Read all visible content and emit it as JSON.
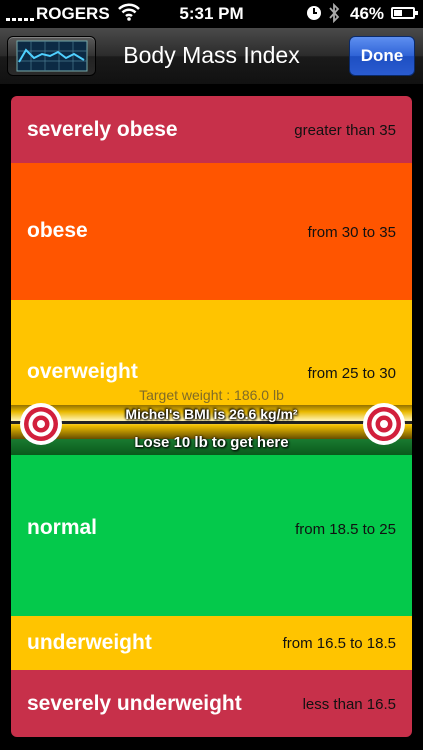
{
  "status_bar": {
    "carrier": "ROGERS",
    "time": "5:31 PM",
    "battery": "46%",
    "battery_level": 0.46
  },
  "nav": {
    "title": "Body Mass Index",
    "done_label": "Done"
  },
  "categories": [
    {
      "name": "severely obese",
      "range": "greater than 35",
      "color": "#c7304a"
    },
    {
      "name": "obese",
      "range": "from 30 to 35",
      "color": "#ff5500"
    },
    {
      "name": "overweight",
      "range": "from 25 to 30",
      "color": "#ffc400"
    },
    {
      "name": "normal",
      "range": "from 18.5 to 25",
      "color": "#04c94b"
    },
    {
      "name": "underweight",
      "range": "from 16.5 to 18.5",
      "color": "#ffc400"
    },
    {
      "name": "severely underweight",
      "range": "less than 16.5",
      "color": "#c7304a"
    }
  ],
  "indicator": {
    "target_weight": "Target weight : 186.0 lb",
    "bmi_text": "Michel's BMI is 26.6 kg/m²",
    "lose_text": "Lose  10 lb to get here"
  },
  "icons": {
    "chart": "line-chart-icon",
    "target": "bullseye-icon"
  }
}
